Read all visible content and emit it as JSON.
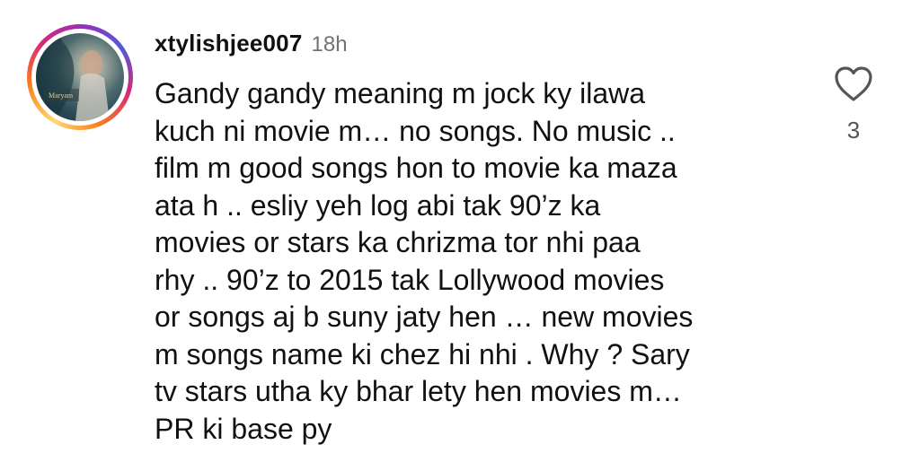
{
  "comment": {
    "username": "xtylishjee007",
    "time": "18h",
    "avatar_caption": "Maryam",
    "text": "Gandy gandy meaning m jock ky ilawa\nkuch ni movie m… no songs. No music ..\nfilm m good songs hon to movie ka maza\nata h .. esliy yeh log abi tak 90’z ka\nmovies or stars ka chrizma tor nhi paa\nrhy .. 90’z to 2015 tak Lollywood movies\nor songs aj b suny jaty hen … new movies\nm songs name ki chez hi nhi . Why ? Sary\ntv stars utha ky bhar lety hen movies m…\nPR ki base py",
    "like_icon": "heart-outline-icon",
    "like_count": "3"
  },
  "colors": {
    "text": "#111111",
    "secondary": "#737373",
    "icon": "#555555",
    "story_ring_start": "#feda75",
    "story_ring_end": "#962fbf"
  }
}
